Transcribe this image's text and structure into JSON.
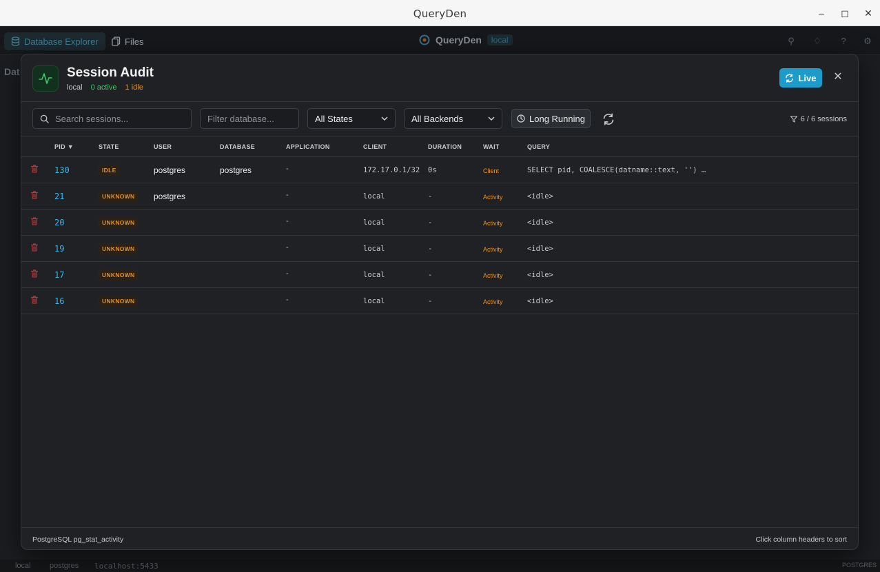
{
  "window": {
    "title": "QueryDen"
  },
  "app": {
    "tabs": [
      {
        "label": "Database Explorer"
      },
      {
        "label": "Files"
      }
    ],
    "brand": "QueryDen",
    "connection": "local",
    "side_title": "Dat",
    "status": {
      "conn": "local",
      "db": "postgres",
      "host": "localhost:5433",
      "right": "POSTGRES"
    }
  },
  "modal": {
    "title": "Session Audit",
    "host": "local",
    "active_label": "0 active",
    "idle_label": "1 idle",
    "live_label": "Live",
    "search_placeholder": "Search sessions...",
    "db_placeholder": "Filter database...",
    "state_select": "All States",
    "backend_select": "All Backends",
    "long_running_label": "Long Running",
    "session_count": "6 / 6 sessions",
    "columns": [
      "PID ▼",
      "STATE",
      "USER",
      "DATABASE",
      "APPLICATION",
      "CLIENT",
      "DURATION",
      "WAIT",
      "QUERY"
    ],
    "rows": [
      {
        "pid": "130",
        "state": "IDLE",
        "user": "postgres",
        "database": "postgres",
        "application": "-",
        "client": "172.17.0.1/32",
        "duration": "0s",
        "wait": "Client",
        "query": "SELECT pid, COALESCE(datname::text, '') …"
      },
      {
        "pid": "21",
        "state": "UNKNOWN",
        "user": "postgres",
        "database": "",
        "application": "-",
        "client": "local",
        "duration": "-",
        "wait": "Activity",
        "query": "<idle>"
      },
      {
        "pid": "20",
        "state": "UNKNOWN",
        "user": "",
        "database": "",
        "application": "-",
        "client": "local",
        "duration": "-",
        "wait": "Activity",
        "query": "<idle>"
      },
      {
        "pid": "19",
        "state": "UNKNOWN",
        "user": "",
        "database": "",
        "application": "-",
        "client": "local",
        "duration": "-",
        "wait": "Activity",
        "query": "<idle>"
      },
      {
        "pid": "17",
        "state": "UNKNOWN",
        "user": "",
        "database": "",
        "application": "-",
        "client": "local",
        "duration": "-",
        "wait": "Activity",
        "query": "<idle>"
      },
      {
        "pid": "16",
        "state": "UNKNOWN",
        "user": "",
        "database": "",
        "application": "-",
        "client": "local",
        "duration": "-",
        "wait": "Activity",
        "query": "<idle>"
      }
    ],
    "footer_left": "PostgreSQL pg_stat_activity",
    "footer_right": "Click column headers to sort"
  },
  "colors": {
    "accent": "#1d9ccc",
    "pid": "#3bb6e6",
    "warn": "#e0902d",
    "active": "#4cc46a",
    "danger": "#c0392b"
  }
}
